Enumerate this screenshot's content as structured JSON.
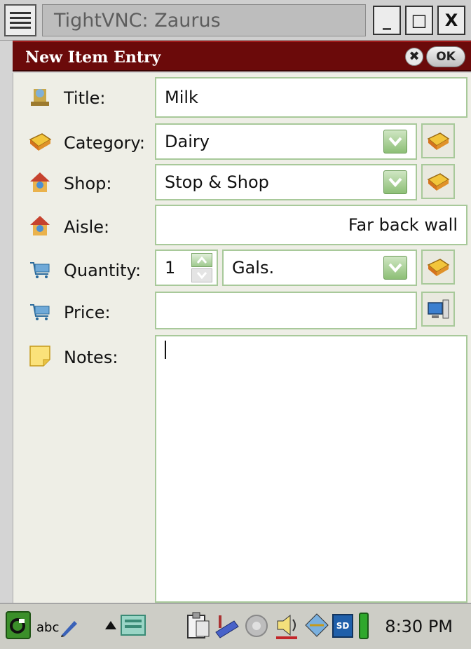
{
  "window": {
    "title": "TightVNC: Zaurus",
    "minimize_label": "_",
    "maximize_label": "□",
    "close_label": "X"
  },
  "app": {
    "title": "New Item Entry",
    "close_label": "✖",
    "ok_label": "OK"
  },
  "form": {
    "title": {
      "label": "Title:",
      "value": "Milk",
      "icon": "grocery-icon"
    },
    "category": {
      "label": "Category:",
      "value": "Dairy",
      "icon": "book-icon"
    },
    "shop": {
      "label": "Shop:",
      "value": "Stop & Shop",
      "icon": "house-icon"
    },
    "aisle": {
      "label": "Aisle:",
      "value": "Far back wall",
      "icon": "house-icon"
    },
    "quantity": {
      "label": "Quantity:",
      "value": "1",
      "unit": "Gals.",
      "icon": "cart-icon"
    },
    "price": {
      "label": "Price:",
      "value": "",
      "icon": "cart-icon"
    },
    "notes": {
      "label": "Notes:",
      "value": "",
      "icon": "note-icon"
    }
  },
  "taskbar": {
    "input_method": "abc",
    "clock": "8:30 PM",
    "sd_label": "SD"
  },
  "colors": {
    "header_bg": "#6b0a0a",
    "field_border": "#a8c99a",
    "form_bg": "#eeeee6"
  }
}
